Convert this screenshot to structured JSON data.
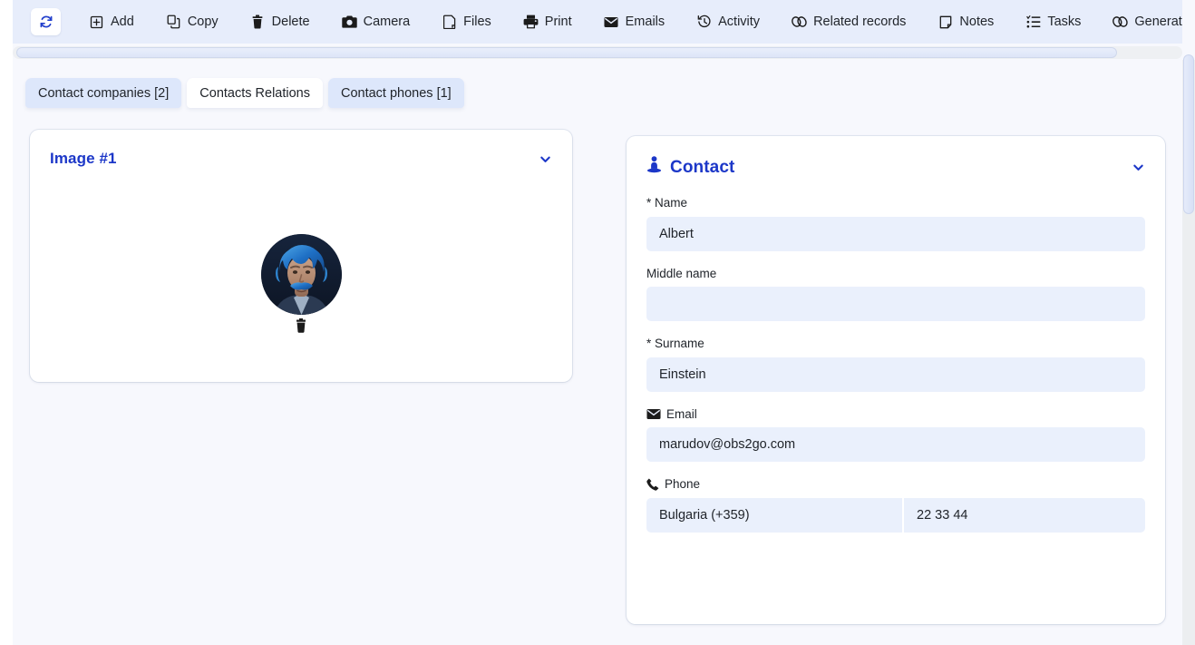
{
  "toolbar": {
    "buttons": [
      {
        "label": "",
        "icon": "refresh-icon",
        "name": "refresh-button"
      },
      {
        "label": "Add",
        "icon": "add-box-icon",
        "name": "add-button"
      },
      {
        "label": "Copy",
        "icon": "copy-icon",
        "name": "copy-button"
      },
      {
        "label": "Delete",
        "icon": "trash-icon",
        "name": "delete-button"
      },
      {
        "label": "Camera",
        "icon": "camera-icon",
        "name": "camera-button"
      },
      {
        "label": "Files",
        "icon": "file-icon",
        "name": "files-button"
      },
      {
        "label": "Print",
        "icon": "printer-icon",
        "name": "print-button"
      },
      {
        "label": "Emails",
        "icon": "envelope-icon",
        "name": "emails-button"
      },
      {
        "label": "Activity",
        "icon": "history-clock-icon",
        "name": "activity-button"
      },
      {
        "label": "Related records",
        "icon": "link-icon",
        "name": "related-records-button"
      },
      {
        "label": "Notes",
        "icon": "note-icon",
        "name": "notes-button"
      },
      {
        "label": "Tasks",
        "icon": "task-list-icon",
        "name": "tasks-button"
      },
      {
        "label": "Generate and attach pdf f",
        "icon": "link-icon",
        "name": "generate-attach-pdf-button"
      }
    ]
  },
  "tabs": [
    {
      "label": "Contact companies [2]",
      "state": "active"
    },
    {
      "label": "Contacts Relations",
      "state": "inactive"
    },
    {
      "label": "Contact phones [1]",
      "state": "active"
    }
  ],
  "image_card": {
    "title": "Image #1",
    "collapse_icon": "chevron-down-icon",
    "avatar_alt": "contact-photo",
    "delete_icon": "trash-icon"
  },
  "contact_card": {
    "title": "Contact",
    "title_icon": "contact-person-icon",
    "collapse_icon": "chevron-down-icon",
    "fields": [
      {
        "label": "* Name",
        "value": "Albert",
        "icon": null,
        "name": "name-field"
      },
      {
        "label": "Middle name",
        "value": "",
        "icon": null,
        "name": "middle-name-field"
      },
      {
        "label": "* Surname",
        "value": "Einstein",
        "icon": null,
        "name": "surname-field"
      },
      {
        "label": "Email",
        "value": "marudov@obs2go.com",
        "icon": "envelope-icon",
        "name": "email-field"
      }
    ],
    "phone": {
      "label": "Phone",
      "icon": "phone-icon",
      "country": "Bulgaria (+359)",
      "number": "22 33 44"
    }
  },
  "colors": {
    "accent": "#1c37c8",
    "toolbar_bg": "#e7edfb",
    "page_bg": "#f7f8fd",
    "input_bg": "#eaf0fc",
    "tab_active_bg": "#dde7fb"
  }
}
